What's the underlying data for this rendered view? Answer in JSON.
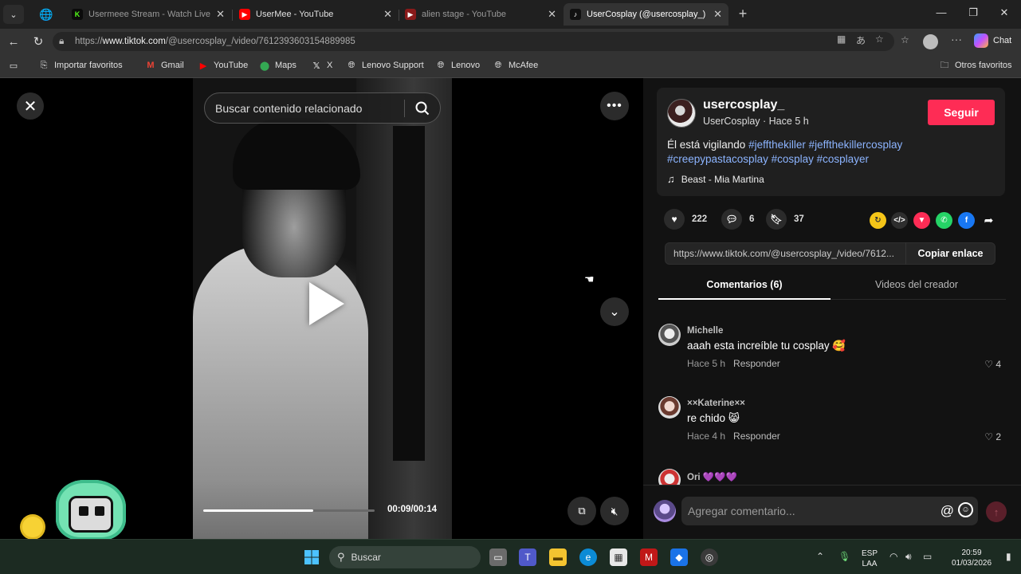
{
  "browser": {
    "tabs": [
      {
        "label": "Usermeee Stream - Watch Live on",
        "active": false
      },
      {
        "label": "UserMee - YouTube",
        "active": false
      },
      {
        "label": "alien stage - YouTube",
        "active": false
      },
      {
        "label": "UserCosplay (@usercosplay_) | Tik",
        "active": true
      }
    ],
    "url_prefix": "https://",
    "url_host": "www.tiktok.com",
    "url_path": "/@usercosplay_/video/7612393603154889985",
    "copilot_label": "Chat",
    "bookmarks": [
      "Importar favoritos",
      "Gmail",
      "YouTube",
      "Maps",
      "X",
      "Lenovo Support",
      "Lenovo",
      "McAfee"
    ],
    "other_bookmarks": "Otros favoritos"
  },
  "search": {
    "placeholder": "Buscar contenido relacionado"
  },
  "video": {
    "time": "00:09/00:14",
    "progress": 0.64
  },
  "post": {
    "username": "usercosplay_",
    "subtitle": "UserCosplay · Hace 5 h",
    "follow_label": "Seguir",
    "desc_text": "Él está vigilando",
    "hashtags": [
      "#jeffthekiller",
      "#jeffthekillercosplay",
      "#creepypastacosplay",
      "#cosplay",
      "#cosplayer"
    ],
    "music": "Beast - Mia Martina",
    "likes": "222",
    "comments": "6",
    "saves": "37",
    "share_url": "https://www.tiktok.com/@usercosplay_/video/7612...",
    "copy_label": "Copiar enlace"
  },
  "panel_tabs": [
    "Comentarios (6)",
    "Videos del creador"
  ],
  "comments": [
    {
      "name": "Michelle",
      "text": "aaah esta increíble tu cosplay 🥰",
      "time": "Hace 5 h",
      "reply": "Responder",
      "likes": "4"
    },
    {
      "name": "××Katerine××",
      "text": "re chido 😸",
      "time": "Hace 4 h",
      "reply": "Responder",
      "likes": "2"
    },
    {
      "name": "Ori 💜💜💜",
      "text": "",
      "time": "",
      "reply": "",
      "likes": ""
    }
  ],
  "comment_input": {
    "placeholder": "Agregar comentario..."
  },
  "taskbar": {
    "search_label": "Buscar",
    "lang_line1": "ESP",
    "lang_line2": "LAA",
    "time": "20:59",
    "date": "01/03/2026"
  },
  "colors": {
    "accent": "#fe2c55",
    "hashtag": "#8cb4ff"
  }
}
